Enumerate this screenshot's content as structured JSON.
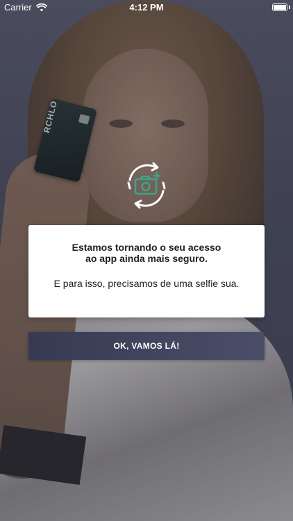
{
  "status_bar": {
    "carrier": "Carrier",
    "time": "4:12 PM",
    "icons": [
      "wifi-icon",
      "battery-icon"
    ]
  },
  "background": {
    "description_icon": "selfie-photo-background",
    "card_brand": "RCHLO"
  },
  "dialog": {
    "icon": "selfie-camera-refresh-icon",
    "title_line1": "Estamos tornando o seu acesso",
    "title_line2": "ao app ainda mais seguro.",
    "message": "E para isso, precisamos de uma selfie sua."
  },
  "cta": {
    "label": "OK, VAMOS LÁ!"
  },
  "colors": {
    "accent_icon": "#3aa58a",
    "button_start": "#363a52",
    "button_end": "#4a4e68",
    "card_bg": "#ffffff",
    "text": "#1f1f1f"
  }
}
